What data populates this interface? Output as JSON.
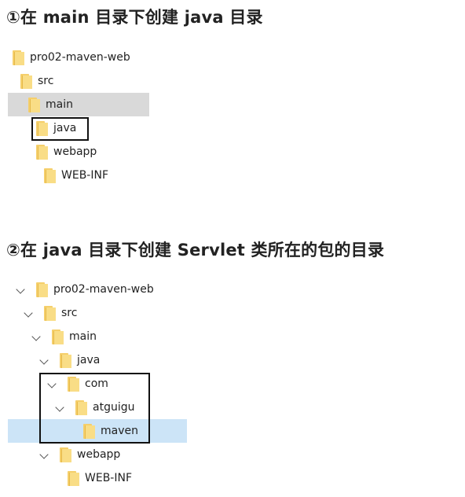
{
  "section1": {
    "title": "①在 main 目录下创建 java 目录",
    "tree": [
      {
        "name": "pro02-maven-web"
      },
      {
        "name": "src"
      },
      {
        "name": "main"
      },
      {
        "name": "java"
      },
      {
        "name": "webapp"
      },
      {
        "name": "WEB-INF"
      }
    ]
  },
  "section2": {
    "title": "②在 java 目录下创建 Servlet 类所在的包的目录",
    "tree": [
      {
        "name": "pro02-maven-web"
      },
      {
        "name": "src"
      },
      {
        "name": "main"
      },
      {
        "name": "java"
      },
      {
        "name": "com"
      },
      {
        "name": "atguigu"
      },
      {
        "name": "maven"
      },
      {
        "name": "webapp"
      },
      {
        "name": "WEB-INF"
      }
    ]
  },
  "colors": {
    "folder": "#f5cf6b",
    "selected_gray": "#d9d9d9",
    "selected_blue": "#cce4f7",
    "highlight_box": "#111111"
  }
}
